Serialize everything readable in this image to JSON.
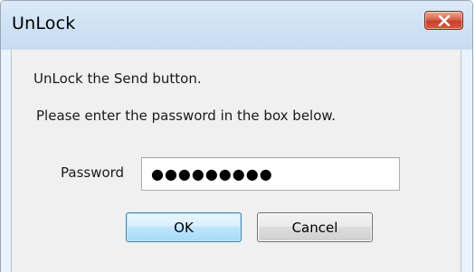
{
  "window": {
    "title": "UnLock",
    "close_icon": "close-x-icon"
  },
  "dialog": {
    "message_line1": "UnLock the Send button.",
    "message_line2": "Please enter the password in the box below.",
    "password_label": "Password",
    "password_value": "●●●●●●●●●",
    "ok_label": "OK",
    "cancel_label": "Cancel"
  },
  "colors": {
    "titlebar": "#cfe1f3",
    "close_button": "#c7412c",
    "client_background": "#f0f0f0",
    "ok_button_border": "#3c7fb1"
  }
}
